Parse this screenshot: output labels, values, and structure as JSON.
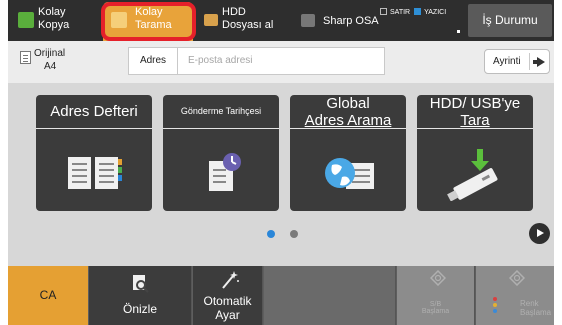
{
  "top_tabs": [
    {
      "label": "Kolay\nKopya"
    },
    {
      "label": "Kolay\nTarama"
    },
    {
      "label": "HDD\nDosyası al"
    },
    {
      "label": "Sharp OSA"
    }
  ],
  "legend": {
    "item1": "SATIR",
    "item2": "YAZICI"
  },
  "job_status_button": "İş Durumu",
  "original": {
    "label": "Orijinal",
    "size": "A4"
  },
  "address": {
    "label": "Adres",
    "placeholder": "E-posta adresi"
  },
  "detail_button": "Ayrinti",
  "cards": [
    {
      "title": "Adres Defteri"
    },
    {
      "title": "Gönderme Tarihçesi"
    },
    {
      "title_line1": "Global",
      "title_line2": "Adres Arama"
    },
    {
      "title_line1": "HDD/ USB'ye",
      "title_line2": "Tara"
    }
  ],
  "pager": {
    "current": 1,
    "total": 2
  },
  "bottom_bar": {
    "ca": "CA",
    "preview": "Önizle",
    "auto_set": "Otomatik\nAyar",
    "bw_start": "S/B\nBaşlama",
    "color_start": "Renk\nBaşlama"
  },
  "colors": {
    "active_tab": "#e8a33a",
    "highlight_ring": "#e5202a",
    "ca_button": "#e5a033",
    "pager_active": "#2a86d8"
  },
  "icons": [
    "kopya-icon",
    "tarama-icon",
    "hdd-folder-icon",
    "sharp-osa-icon",
    "document-icon",
    "arrow-right-icon",
    "address-book-icon",
    "send-history-icon",
    "globe-book-icon",
    "usb-drive-icon",
    "preview-icon",
    "auto-set-icon",
    "start-bw-icon",
    "start-color-icon"
  ]
}
